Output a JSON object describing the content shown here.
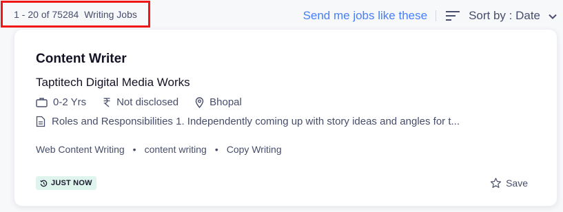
{
  "results": {
    "range": "1 - 20 of 75284",
    "category": "Writing Jobs"
  },
  "actions": {
    "send_jobs_link": "Send me jobs like these",
    "sort_label": "Sort by : Date"
  },
  "job": {
    "title": "Content Writer",
    "company": "Taptitech Digital Media Works",
    "experience": "0-2 Yrs",
    "salary": "Not disclosed",
    "location": "Bhopal",
    "description": "Roles and Responsibilities 1. Independently coming up with story ideas and angles for t...",
    "tags": [
      "Web Content Writing",
      "content writing",
      "Copy Writing"
    ],
    "posted_badge": "JUST NOW",
    "save_label": "Save"
  },
  "colors": {
    "link_blue": "#457eff",
    "highlight_red": "#f01616",
    "badge_bg": "#dff4ec"
  }
}
